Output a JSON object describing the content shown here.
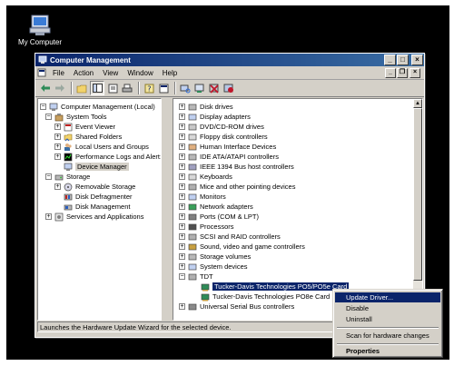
{
  "desktop": {
    "icon_label": "My Computer"
  },
  "window": {
    "title": "Computer Management",
    "menu": [
      "File",
      "Action",
      "View",
      "Window",
      "Help"
    ]
  },
  "left_tree": {
    "root": "Computer Management (Local)",
    "system_tools": "System Tools",
    "event_viewer": "Event Viewer",
    "shared_folders": "Shared Folders",
    "local_users": "Local Users and Groups",
    "perf_logs": "Performance Logs and Alert:",
    "device_manager": "Device Manager",
    "storage": "Storage",
    "removable_storage": "Removable Storage",
    "disk_defrag": "Disk Defragmenter",
    "disk_mgmt": "Disk Management",
    "services": "Services and Applications"
  },
  "right_tree": [
    "Disk drives",
    "Display adapters",
    "DVD/CD-ROM drives",
    "Floppy disk controllers",
    "Human Interface Devices",
    "IDE ATA/ATAPI controllers",
    "IEEE 1394 Bus host controllers",
    "Keyboards",
    "Mice and other pointing devices",
    "Monitors",
    "Network adapters",
    "Ports (COM & LPT)",
    "Processors",
    "SCSI and RAID controllers",
    "Sound, video and game controllers",
    "Storage volumes",
    "System devices",
    "TDT",
    "Tucker-Davis Technologies PO5/PO5e Card",
    "Tucker-Davis Technologies PO8e Card",
    "Universal Serial Bus controllers"
  ],
  "status": "Launches the Hardware Update Wizard for the selected device.",
  "context_menu": {
    "update_driver": "Update Driver...",
    "disable": "Disable",
    "uninstall": "Uninstall",
    "scan": "Scan for hardware changes",
    "properties": "Properties"
  }
}
